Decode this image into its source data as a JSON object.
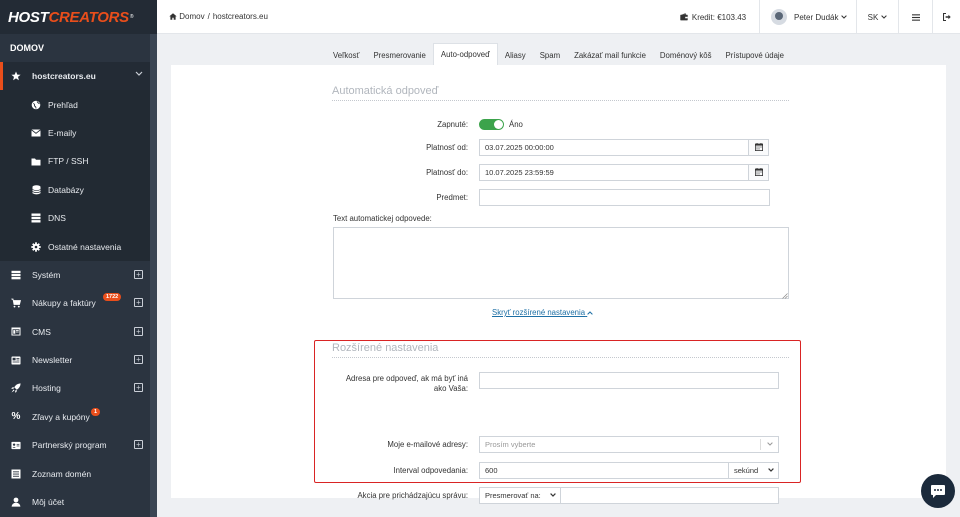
{
  "logo": {
    "part1": "HOST",
    "part2": "CREATORS",
    "mark": "®"
  },
  "sidebar": {
    "section_title": "DOMOV",
    "active_item": {
      "label": "hostcreators.eu",
      "icon": "star-icon"
    },
    "sub_items": [
      {
        "label": "Prehľad",
        "icon": "globe-icon"
      },
      {
        "label": "E-maily",
        "icon": "envelope-icon"
      },
      {
        "label": "FTP / SSH",
        "icon": "folder-icon"
      },
      {
        "label": "Databázy",
        "icon": "database-icon"
      },
      {
        "label": "DNS",
        "icon": "server-icon"
      },
      {
        "label": "Ostatné nastavenia",
        "icon": "gear-icon"
      }
    ],
    "items": [
      {
        "label": "Systém",
        "icon": "layers-icon",
        "expandable": true
      },
      {
        "label": "Nákupy a faktúry",
        "icon": "cart-icon",
        "expandable": true,
        "badge": "1722"
      },
      {
        "label": "CMS",
        "icon": "browser-icon",
        "expandable": true
      },
      {
        "label": "Newsletter",
        "icon": "newspaper-icon",
        "expandable": true
      },
      {
        "label": "Hosting",
        "icon": "rocket-icon",
        "expandable": true
      },
      {
        "label": "Zľavy a kupóny",
        "icon": "percent-icon",
        "expandable": false,
        "badge": "1"
      },
      {
        "label": "Partnerský program",
        "icon": "id-card-icon",
        "expandable": true
      },
      {
        "label": "Zoznam domén",
        "icon": "list-icon",
        "expandable": false
      },
      {
        "label": "Môj účet",
        "icon": "user-icon",
        "expandable": false
      }
    ]
  },
  "topbar": {
    "breadcrumb": {
      "home": "Domov",
      "separator": "/",
      "current": "hostcreators.eu"
    },
    "credit": "Kredit: €103.43",
    "user": "Peter Dudák",
    "lang": "SK"
  },
  "tabs": [
    {
      "label": "Veľkosť",
      "active": false
    },
    {
      "label": "Presmerovanie",
      "active": false
    },
    {
      "label": "Auto-odpoveď",
      "active": true
    },
    {
      "label": "Aliasy",
      "active": false
    },
    {
      "label": "Spam",
      "active": false
    },
    {
      "label": "Zakázať mail funkcie",
      "active": false
    },
    {
      "label": "Doménový kôš",
      "active": false
    },
    {
      "label": "Prístupové údaje",
      "active": false
    }
  ],
  "autoreply": {
    "legend": "Automatická odpoveď",
    "enabled_label": "Zapnuté:",
    "enabled_value": "Áno",
    "valid_from_label": "Platnosť od:",
    "valid_from": "03.07.2025 00:00:00",
    "valid_to_label": "Platnosť do:",
    "valid_to": "10.07.2025 23:59:59",
    "subject_label": "Predmet:",
    "subject": "",
    "text_label": "Text automatickej odpovede:",
    "text": "",
    "toggle_link": "Skryť rozšírené nastavenia"
  },
  "advanced": {
    "legend": "Rozšírené nastavenia",
    "reply_to_label": "Adresa pre odpoveď, ak má byť iná ako Vaša:",
    "reply_to": "",
    "my_emails_label": "Moje e-mailové adresy:",
    "my_emails_placeholder": "Prosím vyberte",
    "interval_label": "Interval odpovedania:",
    "interval_value": "600",
    "interval_unit": "sekúnd",
    "action_label": "Akcia pre prichádzajúcu správu:",
    "action_value": "Presmerovať na:",
    "action_target": ""
  },
  "colors": {
    "accent": "#e94e1b",
    "sidebar": "#2b3440",
    "toggle_on": "#3ca34b",
    "highlight": "#d92424",
    "link": "#1d6fa5"
  }
}
